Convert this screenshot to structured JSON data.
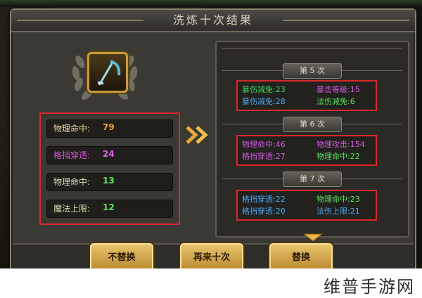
{
  "window": {
    "title": "洗炼十次结果"
  },
  "current_stats": [
    {
      "label": "物理命中:",
      "value": "79",
      "label_color": "#e8d6a0",
      "value_color": "#f0a030"
    },
    {
      "label": "格挡穿透:",
      "value": "24",
      "label_color": "#d05ad8",
      "value_color": "#e060e8"
    },
    {
      "label": "物理命中:",
      "value": "13",
      "label_color": "#cde0b0",
      "value_color": "#58e858"
    },
    {
      "label": "魔法上限:",
      "value": "12",
      "label_color": "#cde0b0",
      "value_color": "#58e858"
    }
  ],
  "rounds": [
    {
      "label": "第 5 次",
      "attrs": [
        {
          "text": "暴伤减免:23",
          "color": "#3ed85a"
        },
        {
          "text": "暴击等级:15",
          "color": "#d25ae0"
        },
        {
          "text": "暴伤减免:28",
          "color": "#4aa8f0"
        },
        {
          "text": "法伤减免:6",
          "color": "#58e060"
        }
      ]
    },
    {
      "label": "第 6 次",
      "attrs": [
        {
          "text": "物理命中:46",
          "color": "#d25ae0"
        },
        {
          "text": "物理攻击:154",
          "color": "#d25ae0"
        },
        {
          "text": "格挡穿透:27",
          "color": "#d25ae0"
        },
        {
          "text": "物理命中:22",
          "color": "#58e060"
        }
      ]
    },
    {
      "label": "第 7 次",
      "attrs": [
        {
          "text": "格挡穿透:22",
          "color": "#4aa8f0"
        },
        {
          "text": "物理命中:23",
          "color": "#58e060"
        },
        {
          "text": "格挡穿透:20",
          "color": "#4aa8f0"
        },
        {
          "text": "法伤上限:21",
          "color": "#4aa8f0"
        }
      ]
    }
  ],
  "buttons": {
    "no_replace": "不替换",
    "again_ten": "再来十次",
    "replace": "替换"
  },
  "watermark": "维普手游网",
  "icons": {
    "emblem": "scythe-weapon-icon",
    "arrow": "double-chevron-right-icon",
    "tab": "chevron-down-icon"
  }
}
